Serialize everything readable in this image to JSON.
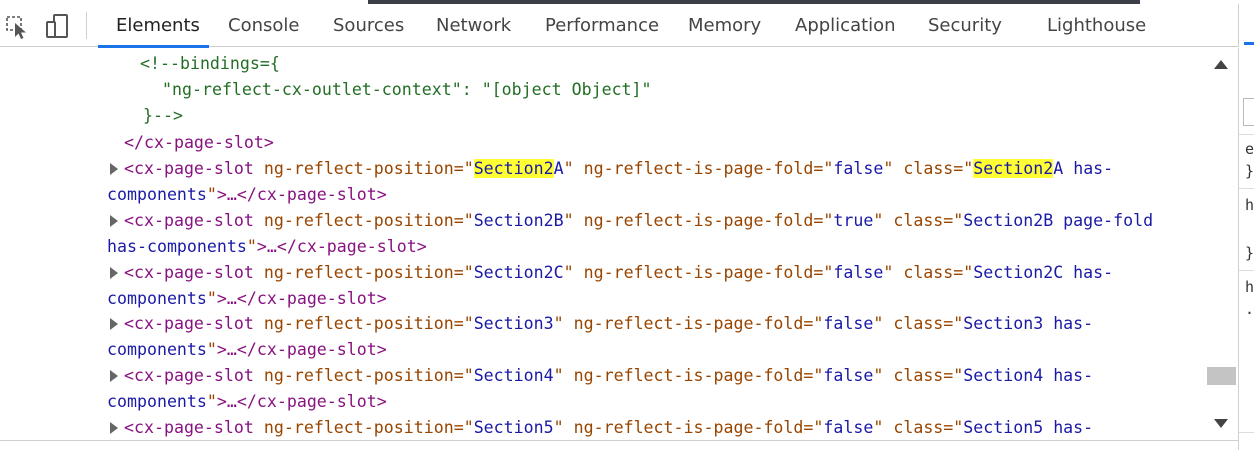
{
  "tabs": [
    {
      "label": "Elements",
      "active": true
    },
    {
      "label": "Console"
    },
    {
      "label": "Sources"
    },
    {
      "label": "Network"
    },
    {
      "label": "Performance"
    },
    {
      "label": "Memory"
    },
    {
      "label": "Application"
    },
    {
      "label": "Security"
    },
    {
      "label": "Lighthouse"
    }
  ],
  "toolbar": {
    "inspect_icon": "cursor-select-icon",
    "device_icon": "device-toggle-icon"
  },
  "code": {
    "comment_open": "<!--bindings={",
    "comment_body": "\"ng-reflect-cx-outlet-context\": \"[object Object]\"",
    "comment_close": "}-->",
    "close_slot": "</cx-page-slot>",
    "slot_open": "<cx-page-slot",
    "attr_position": "ng-reflect-position",
    "attr_fold": "ng-reflect-is-page-fold",
    "attr_class": "class",
    "eq_quote": "=\"",
    "quote": "\"",
    "collapsed_tail": ">…</cx-page-slot>",
    "rows": [
      {
        "position_hl": "Section2",
        "position_rest": "A",
        "fold": "false",
        "class_hl": "Section2",
        "class_rest": "A has-",
        "wrap_prefix": "components"
      },
      {
        "position": "Section2B",
        "fold": "true",
        "class": "Section2B page-fold",
        "wrap_prefix": "has-components"
      },
      {
        "position": "Section2C",
        "fold": "false",
        "class": "Section2C has-",
        "wrap_prefix": "components"
      },
      {
        "position": "Section3",
        "fold": "false",
        "class": "Section3 has-",
        "wrap_prefix": "components"
      },
      {
        "position": "Section4",
        "fold": "false",
        "class": "Section4 has-",
        "wrap_prefix": "components"
      },
      {
        "position": "Section5",
        "fold": "false",
        "class": "Section5 has-"
      }
    ]
  },
  "side_panel": {
    "glyphs": [
      "e",
      "}",
      "h",
      "}",
      "h",
      "."
    ]
  },
  "colors": {
    "tag": "#881280",
    "attr": "#994500",
    "value": "#1a1aa6",
    "comment": "#236e25",
    "highlight": "#ffff33",
    "accent": "#1a73e8"
  }
}
